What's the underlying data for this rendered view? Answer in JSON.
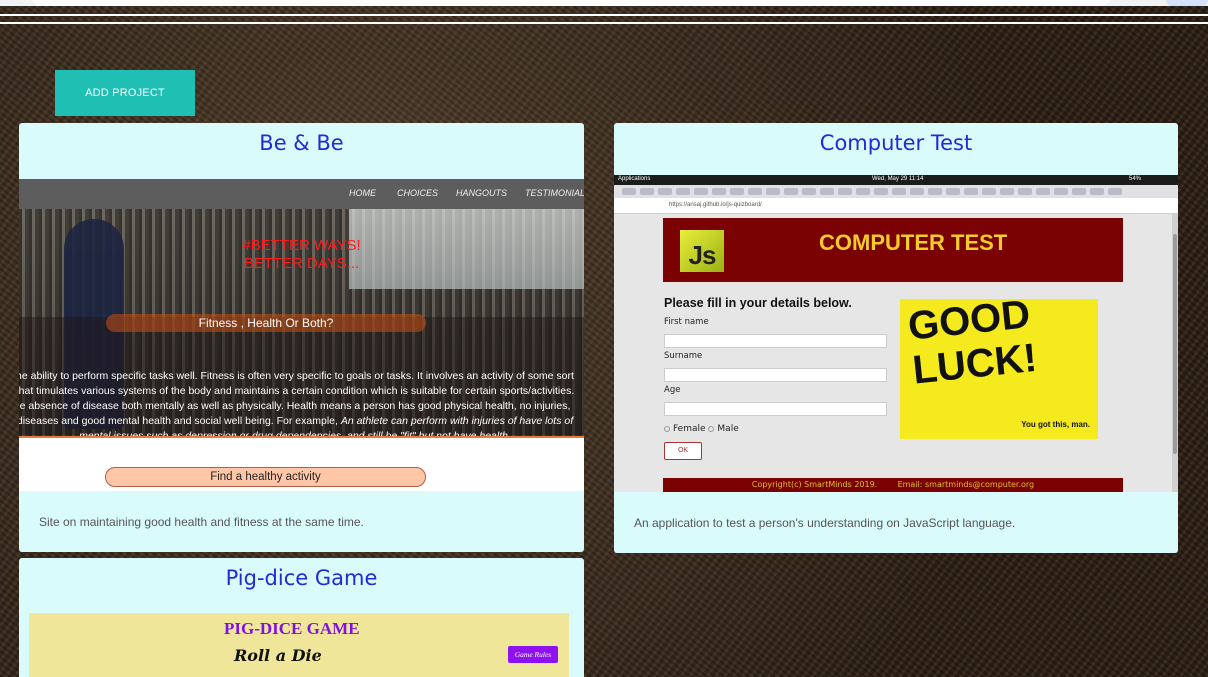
{
  "toolbar": {
    "add_project_label": "ADD PROJECT"
  },
  "projects": [
    {
      "title": "Be & Be",
      "description": "Site on maintaining good health and fitness at the same time.",
      "preview": {
        "nav": [
          "HOME",
          "CHOICES",
          "HANGOUTS",
          "TESTIMONIALS"
        ],
        "headline_1": "#BETTER WAYS!",
        "headline_2": "BETTER DAYS...",
        "question": "Fitness , Health Or Both?",
        "paragraph": "he ability to perform specific tasks well. Fitness is often very specific to goals or tasks. It involves an activity of some sort that timulates various systems of the body and maintains a certain condition which is suitable for certain sports/activities. e absence of disease both mentally as well as physically. Health means a person has good physical health, no injuries, diseases and good mental health and social well being. For example,",
        "paragraph_italic": "An athlete can perform with injuries of have lots of mental issues such as depression or drug dependencies, and still be \"fit\" but not have health.",
        "button": "Find a healthy activity"
      }
    },
    {
      "title": "Computer Test",
      "description": "An application to test a person's understanding on JavaScript language.",
      "preview": {
        "os_left": "Applications",
        "os_clock": "Wed, May 29  11:14",
        "os_battery": "54%",
        "url": "https://ansaj.github.io/js-quizboard/",
        "logo": "Js",
        "heading": "COMPUTER TEST",
        "form_heading": "Please fill in your details below.",
        "fields": [
          "First name",
          "Surname",
          "Age"
        ],
        "radio_female": "Female",
        "radio_male": "Male",
        "ok_button": "OK",
        "good_luck": "GOOD LUCK!",
        "tagline": "You got this, man.",
        "footer": "Copyright(c) SmartMinds 2019.        Email: smartminds@computer.org"
      }
    },
    {
      "title": "Pig-dice Game",
      "preview": {
        "heading": "PIG-DICE GAME",
        "subheading": "Roll a Die",
        "rules_button": "Game Rules"
      }
    }
  ],
  "colors": {
    "accent_button": "#1fbfb3",
    "card_background": "#d9fbfc",
    "card_title": "#1f2bd6"
  }
}
